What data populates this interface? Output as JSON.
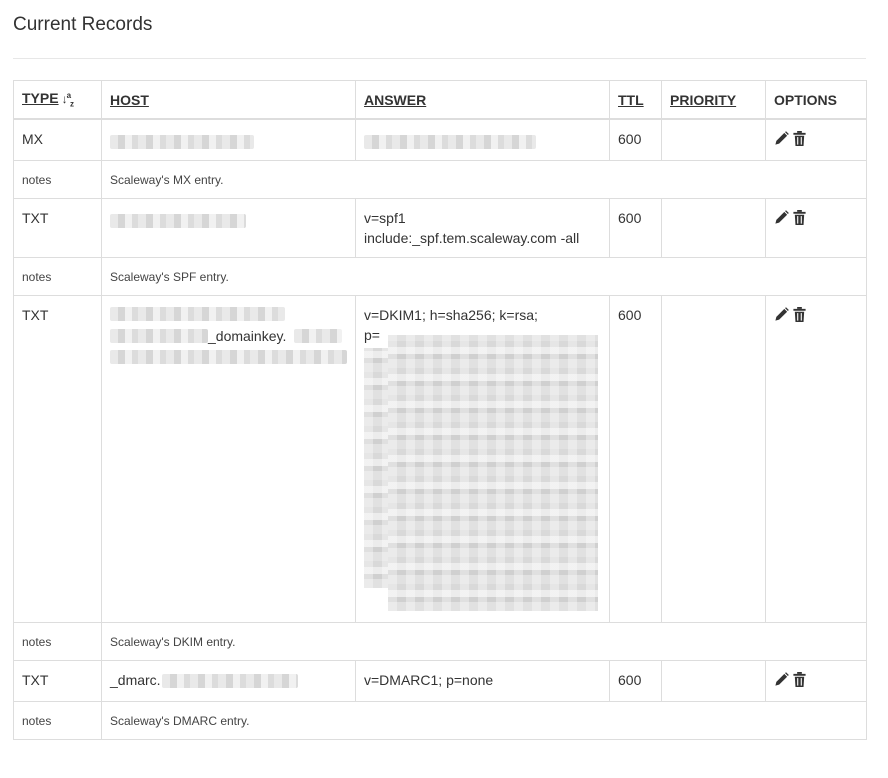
{
  "section": {
    "title": "Current Records"
  },
  "table": {
    "headers": {
      "type": "TYPE",
      "type_sort_icon": "↓a-z sort-icon",
      "host": "HOST",
      "answer": "ANSWER",
      "ttl": "TTL",
      "priority": "PRIORITY",
      "options": "OPTIONS"
    },
    "rows": [
      {
        "type": "MX",
        "host": "[redacted]",
        "answer": "[redacted]",
        "ttl": "600",
        "priority": "",
        "notes_label": "notes",
        "notes": "Scaleway's MX entry."
      },
      {
        "type": "TXT",
        "host": "[redacted]",
        "answer": "v=spf1 include:_spf.tem.scaleway.com -all",
        "ttl": "600",
        "priority": "",
        "notes_label": "notes",
        "notes": "Scaleway's SPF entry."
      },
      {
        "type": "TXT",
        "host_visible": "_domainkey.",
        "answer_prefix": "v=DKIM1; h=sha256; k=rsa;",
        "answer_p": "p=",
        "ttl": "600",
        "priority": "",
        "notes_label": "notes",
        "notes": "Scaleway's DKIM entry."
      },
      {
        "type": "TXT",
        "host_visible": "_dmarc.",
        "answer": "v=DMARC1; p=none",
        "ttl": "600",
        "priority": "",
        "notes_label": "notes",
        "notes": "Scaleway's DMARC entry."
      }
    ]
  },
  "icons": {
    "edit": "pencil-icon",
    "delete": "trash-icon"
  },
  "colors": {
    "border": "#dddddd",
    "text": "#333333",
    "redaction": "#d6d6d6"
  }
}
